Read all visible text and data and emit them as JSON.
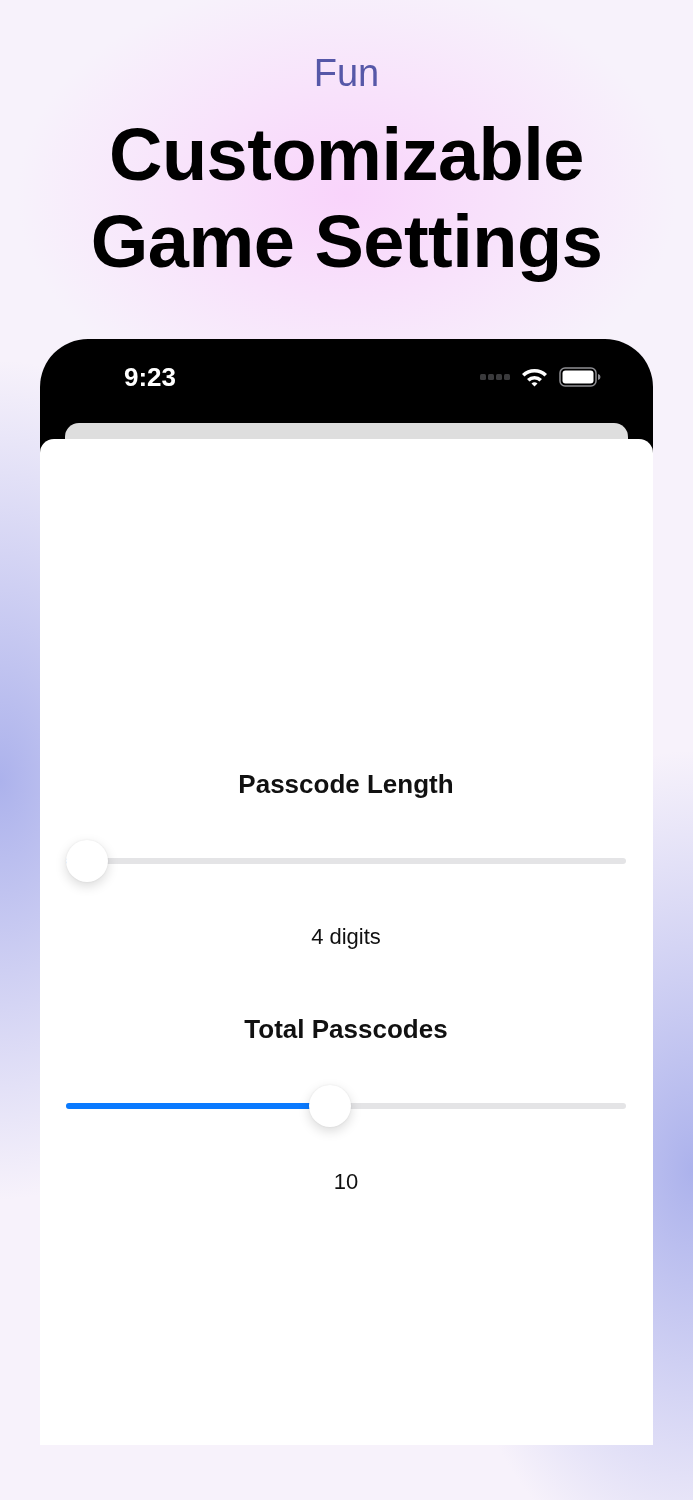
{
  "header": {
    "eyebrow": "Fun",
    "title": "Customizable Game Settings"
  },
  "status_bar": {
    "time": "9:23"
  },
  "settings": [
    {
      "label": "Passcode Length",
      "level": 0,
      "reading": "4 digits"
    },
    {
      "label": "Total Passcodes",
      "level": 0.47,
      "reading": "10"
    }
  ]
}
